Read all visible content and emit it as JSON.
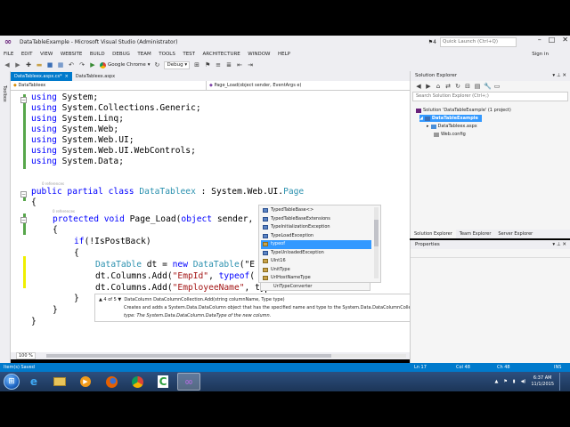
{
  "window": {
    "title": "DataTableExample - Microsoft Visual Studio (Administrator)",
    "quick_launch_placeholder": "Quick Launch (Ctrl+Q)",
    "notification_count": "4",
    "sign_in": "Sign in"
  },
  "menu": [
    "FILE",
    "EDIT",
    "VIEW",
    "WEBSITE",
    "BUILD",
    "DEBUG",
    "TEAM",
    "TOOLS",
    "TEST",
    "ARCHITECTURE",
    "WINDOW",
    "HELP"
  ],
  "toolbar": {
    "browser": "Google Chrome",
    "configuration": "Debug"
  },
  "toolbox_label": "Toolbox",
  "tabs": [
    {
      "label": "DataTableex.aspx.cs*",
      "close": "×"
    },
    {
      "label": "DataTableex.aspx"
    }
  ],
  "navbar": {
    "class_dd": "DataTableex",
    "member_dd": "Page_Load(object sender, EventArgs e)"
  },
  "code": {
    "lines": [
      {
        "kw": "using",
        "rest": " System;"
      },
      {
        "kw": "using",
        "rest": " System.Collections.Generic;"
      },
      {
        "kw": "using",
        "rest": " System.Linq;"
      },
      {
        "kw": "using",
        "rest": " System.Web;"
      },
      {
        "kw": "using",
        "rest": " System.Web.UI;"
      },
      {
        "kw": "using",
        "rest": " System.Web.UI.WebControls;"
      },
      {
        "kw": "using",
        "rest": " System.Data;"
      }
    ],
    "refs_label": "0 references",
    "class_decl": {
      "mods": "public partial class",
      "name": "DataTableex",
      "rest": " : System.Web.UI.",
      "base": "Page"
    },
    "open_brace": "{",
    "method_decl": {
      "mods": "protected void",
      "rest": " Page_Load(",
      "p1": "object",
      "rest2": " sender, E"
    },
    "inner_open": "{",
    "if_line": {
      "kw": "if",
      "rest": "(!IsPostBack)"
    },
    "if_open": "{",
    "dt_line": {
      "type": "DataTable",
      "rest1": " dt = ",
      "kw": "new",
      "type2": "DataTable",
      "rest2": "(\"E"
    },
    "add1": {
      "pre": "dt.Columns.Add(",
      "str": "\"EmpId\"",
      "mid": ", ",
      "kw": "typeof",
      "post": "("
    },
    "add2": {
      "pre": "dt.Columns.Add(",
      "str": "\"EmployeeName\"",
      "post": ", ty"
    },
    "close_if": "}",
    "close_method": "}",
    "close_class": "}"
  },
  "intellisense": {
    "items": [
      {
        "label": "TypedTableBase<>",
        "kind": "class"
      },
      {
        "label": "TypedTableBaseExtensions",
        "kind": "class"
      },
      {
        "label": "TypeInitializationException",
        "kind": "class"
      },
      {
        "label": "TypeLoadException",
        "kind": "class"
      },
      {
        "label": "typeof",
        "kind": "keyword",
        "selected": true
      },
      {
        "label": "TypeUnloadedException",
        "kind": "class"
      },
      {
        "label": "UInt16",
        "kind": "struct"
      },
      {
        "label": "UnitType",
        "kind": "enum"
      },
      {
        "label": "UrlHostNameType",
        "kind": "enum"
      },
      {
        "label": "UriTypeConverter",
        "kind": "class"
      }
    ]
  },
  "signature": {
    "counter": "▲ 4 of 5 ▼",
    "sig": "DataColumn DataColumnCollection.Add(string columnName, Type type)",
    "desc": "Creates and adds a System.Data.DataColumn object that has the specified name and type to the System.Data.DataColumnCollection.",
    "param": "type: The System.Data.DataColumn.DataType of the new column."
  },
  "zoom": "100 %",
  "solution_explorer": {
    "title": "Solution Explorer",
    "search_placeholder": "Search Solution Explorer (Ctrl+;)",
    "tree": [
      {
        "label": "Solution 'DataTableExample' (1 project)"
      },
      {
        "label": "DataTableExample",
        "selected": true
      },
      {
        "label": "DataTableex.aspx"
      },
      {
        "label": "Web.config"
      }
    ],
    "tabs": [
      "Solution Explorer",
      "Team Explorer",
      "Server Explorer"
    ]
  },
  "properties": {
    "title": "Properties"
  },
  "status": {
    "message": "Item(s) Saved",
    "ln": "Ln 17",
    "col": "Col 48",
    "ch": "Ch 48",
    "mode": "INS"
  },
  "taskbar": {
    "time": "6:37 AM",
    "date": "11/1/2015"
  }
}
